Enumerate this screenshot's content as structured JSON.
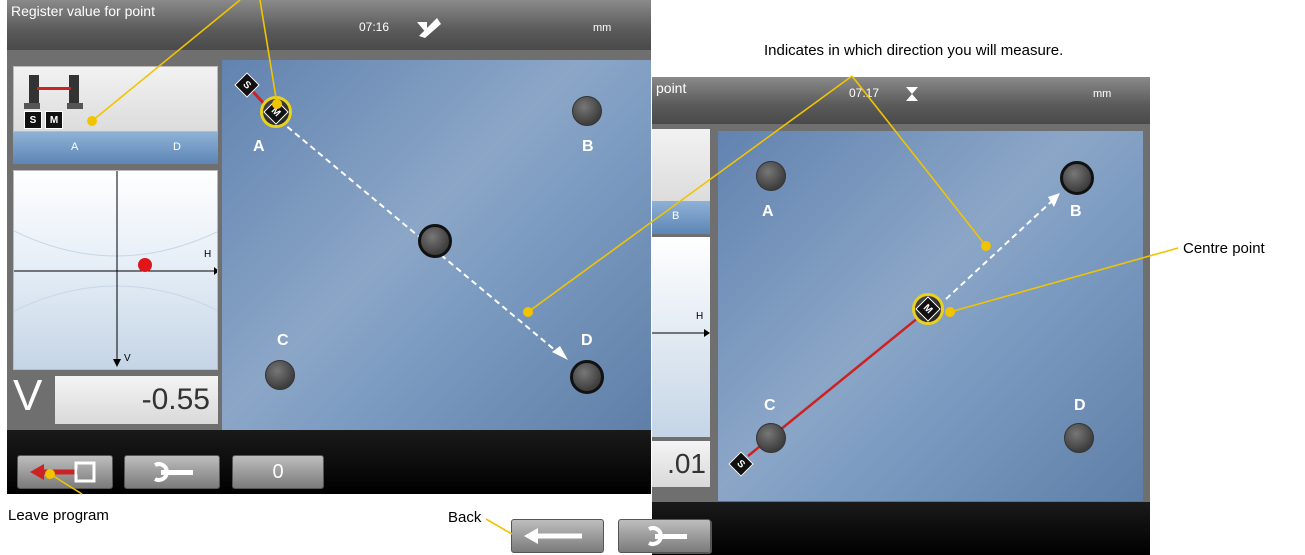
{
  "screen1": {
    "title": "Register value for point",
    "time": "07:16",
    "unit": "mm",
    "machine_tabs": [
      "A",
      "D"
    ],
    "sensor_labels": [
      "S",
      "M"
    ],
    "target_axis_h": "H",
    "target_axis_v": "V",
    "value_axis": "V",
    "value": "-0.55",
    "points": [
      "A",
      "B",
      "C",
      "D"
    ],
    "buttons": {
      "exit_icon": "exit-arrow-icon",
      "wrench_icon": "wrench-icon",
      "zero_label": "0"
    }
  },
  "screen2": {
    "title_fragment": "point",
    "time": "07:17",
    "unit": "mm",
    "tab_fragment": "B",
    "axis_h": "H",
    "value_fragment": ".01",
    "points": [
      "A",
      "B",
      "C",
      "D"
    ],
    "sensor_labels": [
      "S",
      "M"
    ],
    "buttons": {
      "back_icon": "back-arrow-icon",
      "wrench_icon": "wrench-icon"
    }
  },
  "callouts": {
    "direction": "Indicates in which direction you will measure.",
    "centre": "Centre point",
    "leave": "Leave program",
    "back": "Back"
  },
  "colors": {
    "callout_line": "#f2c400",
    "highlight_ring": "#e8d21e",
    "target_dot": "#e0161b",
    "measure_line": "#d01a22"
  }
}
